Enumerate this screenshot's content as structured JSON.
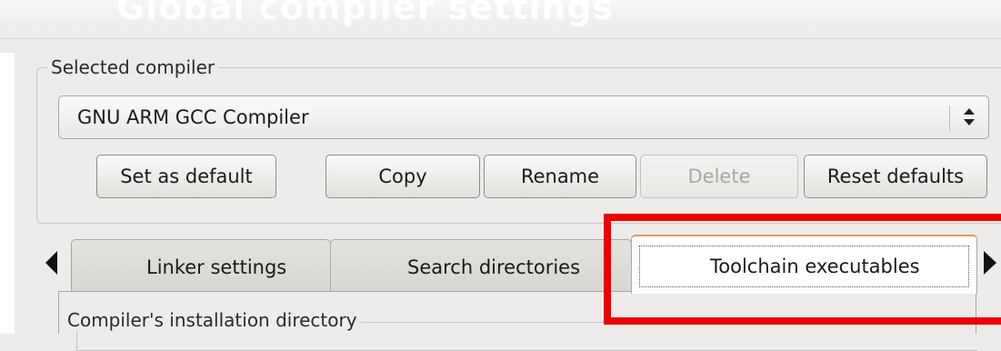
{
  "dialog": {
    "title": "Global compiler settings"
  },
  "selected_compiler": {
    "legend": "Selected compiler",
    "value": "GNU ARM GCC Compiler"
  },
  "buttons": {
    "set_default": "Set as default",
    "copy": "Copy",
    "rename": "Rename",
    "delete": "Delete",
    "reset_defaults": "Reset defaults"
  },
  "tabs": [
    {
      "label": "Linker settings",
      "active": false
    },
    {
      "label": "Search directories",
      "active": false
    },
    {
      "label": "Toolchain executables",
      "active": true
    }
  ],
  "panel": {
    "install_dir_legend": "Compiler's installation directory"
  },
  "colors": {
    "highlight": "#ee0000",
    "active_tab_accent": "#e39a5a"
  }
}
